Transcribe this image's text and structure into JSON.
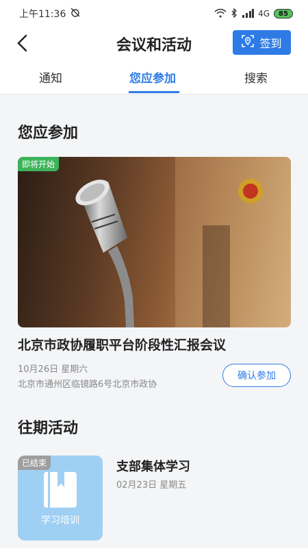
{
  "status_bar": {
    "time": "上午11:36",
    "network": "4G",
    "battery": "85"
  },
  "header": {
    "title": "会议和活动",
    "checkin_label": "签到"
  },
  "tabs": [
    {
      "label": "通知"
    },
    {
      "label": "您应参加"
    },
    {
      "label": "搜索"
    }
  ],
  "should_attend": {
    "section_title": "您应参加",
    "meeting": {
      "status_badge": "即将开始",
      "title": "北京市政协履职平台阶段性汇报会议",
      "date": "10月26日  星期六",
      "location": "北京市通州区临镜路6号北京市政协",
      "confirm_label": "确认参加"
    }
  },
  "past": {
    "section_title": "往期活动",
    "items": [
      {
        "status_badge": "已结束",
        "thumb_label": "学习培训",
        "title": "支部集体学习",
        "date": "02月23日  星期五"
      }
    ]
  },
  "colors": {
    "accent": "#2e7be6",
    "badge_green": "#3cb35a",
    "badge_gray": "#9e9e9e"
  }
}
